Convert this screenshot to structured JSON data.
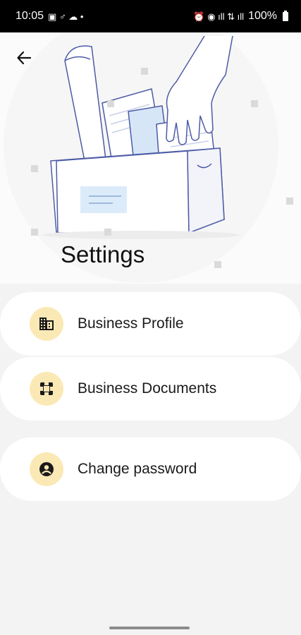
{
  "status_bar": {
    "time": "10:05",
    "battery_text": "100%",
    "left_glyphs": "▣ ♂ ☁ •",
    "right_glyphs": "⏰ ◉ ıll ⇅ ıll"
  },
  "header": {
    "title": "Settings"
  },
  "menu": {
    "items": [
      {
        "label": "Business Profile",
        "icon": "building-icon"
      },
      {
        "label": "Business Documents",
        "icon": "document-frame-icon"
      },
      {
        "label": "Change password",
        "icon": "account-circle-icon"
      }
    ]
  },
  "colors": {
    "icon_circle_bg": "#fbe9b5",
    "page_bg": "#f3f3f3",
    "card_bg": "#ffffff"
  }
}
